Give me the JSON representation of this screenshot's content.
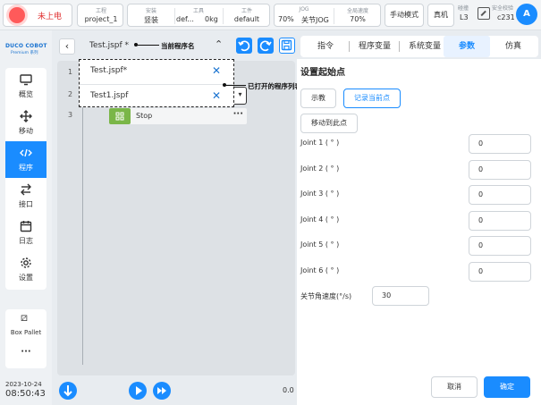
{
  "status": {
    "power_label": "未上电",
    "project_label": "工程",
    "project_value": "project_1",
    "install_label": "安装",
    "install_value": "竖装",
    "tool_label": "工具",
    "tool_value": "def...",
    "tool_mass": "0kg",
    "workpiece_label": "工件",
    "workpiece_value": "default",
    "jog_label": "JOG",
    "jog_percent": "70%",
    "jog_mode": "关节JOG",
    "global_speed_label": "全局速度",
    "global_speed_value": "70%",
    "manual_mode": "手动模式",
    "real_machine": "真机",
    "collision_label": "碰撞",
    "collision_value": "L3",
    "safety_label": "安全校验",
    "safety_value": "c231",
    "avatar_letter": "A"
  },
  "sidebar": {
    "logo": "DUCO COBOT",
    "logo_sub": "Premium 系列",
    "items": [
      {
        "label": "概览",
        "icon": "monitor-icon"
      },
      {
        "label": "移动",
        "icon": "move-icon"
      },
      {
        "label": "程序",
        "icon": "code-icon"
      },
      {
        "label": "接口",
        "icon": "swap-icon"
      },
      {
        "label": "日志",
        "icon": "calendar-icon"
      },
      {
        "label": "设置",
        "icon": "gear-icon"
      }
    ],
    "box_pallet": "Box Pallet",
    "more": "···",
    "date": "2023-10-24",
    "time": "08:50:43"
  },
  "editor": {
    "current_program": "Test.jspf *",
    "line_numbers": [
      "1",
      "2",
      "3"
    ],
    "stop_label": "Stop",
    "speed_readout": "0.0",
    "open_programs": [
      "Test.jspf*",
      "Test1.jspf"
    ],
    "annotation_current": "当前程序名",
    "annotation_opened": "已打开的程序列表"
  },
  "tabs": [
    "指令",
    "程序变量",
    "系统变量",
    "参数",
    "仿真"
  ],
  "params": {
    "title": "设置起始点",
    "teach_btn": "示教",
    "record_btn": "记录当前点",
    "move_btn": "移动到此点",
    "joints": [
      {
        "label": "Joint 1 ( ° )",
        "value": "0"
      },
      {
        "label": "Joint 2 ( ° )",
        "value": "0"
      },
      {
        "label": "Joint 3 ( ° )",
        "value": "0"
      },
      {
        "label": "Joint 4 ( ° )",
        "value": "0"
      },
      {
        "label": "Joint 5 ( ° )",
        "value": "0"
      },
      {
        "label": "Joint 6 ( ° )",
        "value": "0"
      }
    ],
    "joint_speed_label": "关节角速度(°/s)",
    "joint_speed_value": "30",
    "cancel_btn": "取消",
    "confirm_btn": "确定"
  },
  "colors": {
    "accent": "#1a8cff",
    "danger": "#ff5a5a",
    "stop_green": "#7ab648"
  }
}
